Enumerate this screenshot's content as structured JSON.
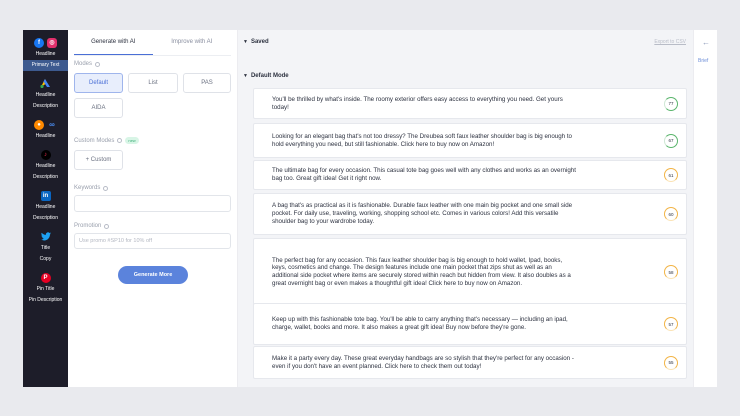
{
  "sidebar": {
    "groups": [
      {
        "icons": [
          "facebook-icon",
          "instagram-icon"
        ],
        "labels": [
          "Headline",
          "Primary Text"
        ],
        "active": 1
      },
      {
        "icons": [
          "google-ads-icon"
        ],
        "labels": [
          "Headline",
          "Description"
        ],
        "active": -1
      },
      {
        "icons": [
          "reddit-icon",
          "microsoft-icon"
        ],
        "labels": [
          "Headline"
        ],
        "active": -1
      },
      {
        "icons": [
          "tiktok-icon"
        ],
        "labels": [
          "Headline",
          "Description"
        ],
        "active": -1
      },
      {
        "icons": [
          "linkedin-icon"
        ],
        "labels": [
          "Headline",
          "Description"
        ],
        "active": -1
      },
      {
        "icons": [
          "twitter-icon"
        ],
        "labels": [
          "Title",
          "Copy"
        ],
        "active": -1
      },
      {
        "icons": [
          "pinterest-icon"
        ],
        "labels": [
          "Pin Title",
          "Pin Description"
        ],
        "active": -1
      }
    ]
  },
  "panel": {
    "tabs": [
      "Generate with AI",
      "Improve with AI"
    ],
    "modes_label": "Modes",
    "modes": [
      "Default",
      "List",
      "PAS",
      "AIDA"
    ],
    "custom_modes_label": "Custom Modes",
    "new_badge": "new",
    "custom_button": "+ Custom",
    "keywords_label": "Keywords",
    "keywords_value": "",
    "promotion_label": "Promotion",
    "promotion_placeholder": "Use promo #SP10 for 10% off",
    "generate_button": "Generate More"
  },
  "main": {
    "saved_label": "Saved",
    "export_label": "Export to CSV",
    "default_mode_label": "Default Mode",
    "results": [
      {
        "text": "You'll be thrilled by what's inside. The roomy exterior offers easy access to everything you need. Get yours today!",
        "score": "77",
        "level": "green"
      },
      {
        "text": "Looking for an elegant bag that's not too dressy? The Dreubea soft faux leather shoulder bag is big enough to hold everything you need, but still fashionable. Click here to buy now on Amazon!",
        "score": "67",
        "level": "green"
      },
      {
        "text": "The ultimate bag for every occasion. This casual tote bag goes well with any clothes and works as an overnight bag too. Great gift idea! Get it right now.",
        "score": "61",
        "level": "orange"
      },
      {
        "text": "A bag that's as practical as it is fashionable. Durable faux leather with one main big pocket and one small side pocket. For daily use, traveling, working, shopping school etc. Comes in various colors! Add this versatile shoulder bag to your wardrobe today.",
        "score": "60",
        "level": "orange"
      },
      {
        "text": "The perfect bag for any occasion. This faux leather shoulder bag is big enough to hold wallet, Ipad, books, keys, cosmetics and change. The design features include one main pocket that zips shut as well as an additional side pocket where items are securely stored within reach but hidden from view. It also doubles as a great overnight bag or even makes a thoughtful gift idea! Click here to buy now on Amazon.",
        "score": "58",
        "level": "orange"
      },
      {
        "text": "Keep up with this fashionable tote bag. You'll be able to carry anything that's necessary — including an ipad, charge, wallet, books and more. It also makes a great gift idea! Buy now before they're gone.",
        "score": "57",
        "level": "orange"
      },
      {
        "text": "Make it a party every day. These great everyday handbags are so stylish that they're perfect for any occasion - even if you don't have an event planned. Click here to check them out today!",
        "score": "55",
        "level": "orange"
      }
    ]
  },
  "right_panel": {
    "back_icon": "arrow-left-icon",
    "brief_label": "Brief"
  },
  "colors": {
    "sidebar_bg": "#1d1d29",
    "accent": "#5b83dc",
    "score_green": "#5ab56c",
    "score_orange": "#f2b446"
  }
}
